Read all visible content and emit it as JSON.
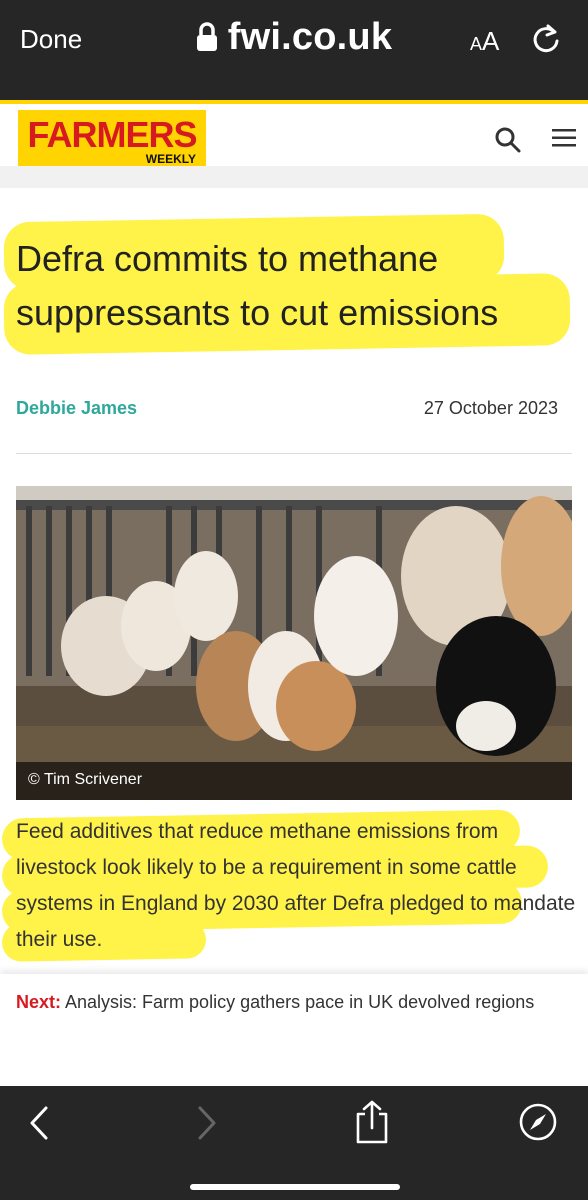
{
  "browser": {
    "done_label": "Done",
    "url": "fwi.co.uk",
    "aa_label_small": "A",
    "aa_label_large": "A"
  },
  "site": {
    "logo_main": "FARMERS",
    "logo_sub": "WEEKLY",
    "brand_yellow": "#ffd400",
    "brand_red": "#d71920"
  },
  "article": {
    "title": "Defra commits to methane suppressants to cut emissions",
    "author": "Debbie James",
    "date": "27 October 2023",
    "photo_caption": "© Tim Scrivener",
    "standfirst": "Feed additives that reduce methane emissions from livestock look likely to be a requirement in some cattle systems in England by 2030 after Defra pledged to mandate their use.",
    "author_color": "#2ea89b",
    "highlight_color": "#fff34a"
  },
  "next": {
    "label": "Next:",
    "text": " Analysis: Farm policy gathers pace in UK devolved regions"
  },
  "icons": {
    "lock": "lock-icon",
    "reload": "reload-icon",
    "search": "search-icon",
    "menu": "hamburger-menu-icon",
    "back": "chevron-left-icon",
    "forward": "chevron-right-icon",
    "share": "share-icon",
    "compass": "compass-icon"
  }
}
